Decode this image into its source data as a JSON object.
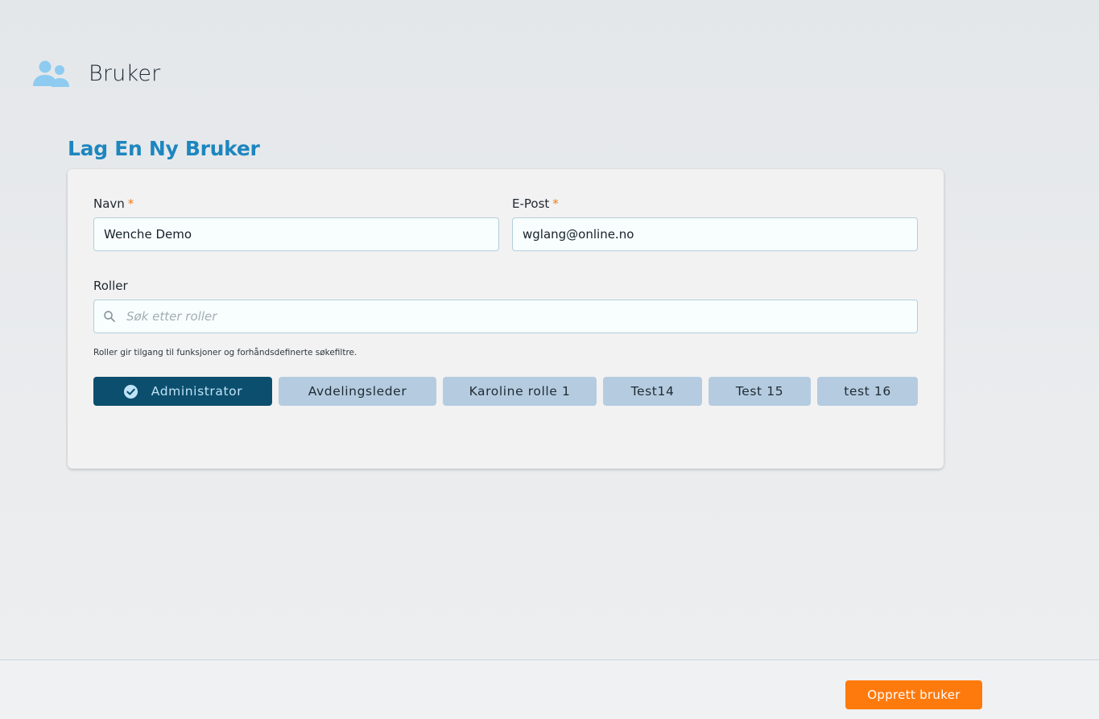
{
  "header": {
    "icon": "users-icon",
    "title": "Bruker"
  },
  "form": {
    "heading": "Lag En Ny Bruker",
    "name_label": "Navn",
    "name_required": "*",
    "name_value": "Wenche Demo",
    "email_label": "E-Post",
    "email_required": "*",
    "email_value": "wglang@online.no",
    "roles_label": "Roller",
    "roles_search_icon": "search-icon",
    "roles_search_placeholder": "Søk etter roller",
    "roles_hint": "Roller gir tilgang til funksjoner og forhåndsdefinerte søkefiltre.",
    "roles": [
      {
        "label": "Administrator",
        "selected": true
      },
      {
        "label": "Avdelingsleder",
        "selected": false
      },
      {
        "label": "Karoline rolle 1",
        "selected": false
      },
      {
        "label": "Test14",
        "selected": false
      },
      {
        "label": "Test 15",
        "selected": false
      },
      {
        "label": "test 16",
        "selected": false
      }
    ]
  },
  "footer": {
    "create_label": "Opprett bruker"
  },
  "colors": {
    "accent_blue": "#1e86bf",
    "selected_chip": "#0c4e6d",
    "chip": "#b5cce0",
    "primary_button": "#ff7a0d",
    "required_mark": "#ef7d1a"
  }
}
